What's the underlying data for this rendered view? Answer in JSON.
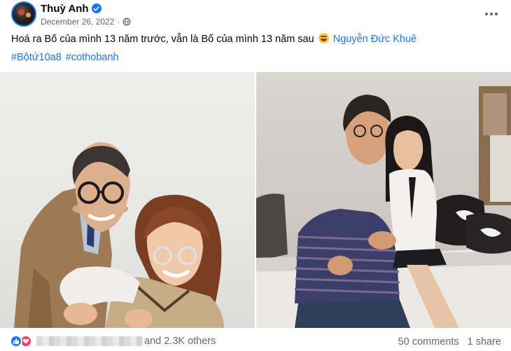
{
  "post": {
    "author": "Thuỳ Anh",
    "date": "December 26, 2022",
    "separator": "·",
    "caption": {
      "text": "Hoá ra Bố của mình 13 năm trước, vẫn là Bố của mình 13 năm sau",
      "emoji": "laughing-emoji",
      "mention": "Nguyễn Đức Khuê"
    },
    "hashtags": [
      "#Bộtứ10a8",
      "#cothobanh"
    ],
    "icons": {
      "verified": "verified-badge-icon",
      "privacy": "globe-icon",
      "more": "more-options-icon",
      "like": "like-reaction-icon",
      "love": "love-reaction-icon"
    }
  },
  "photos": {
    "left": "photo-left",
    "right": "photo-right"
  },
  "footer": {
    "reaction_text": "and 2.3K others",
    "comments": "50 comments",
    "shares": "1 share"
  },
  "colors": {
    "link": "#1877f2",
    "secondary_text": "#65676b",
    "love": "#f33e58"
  }
}
